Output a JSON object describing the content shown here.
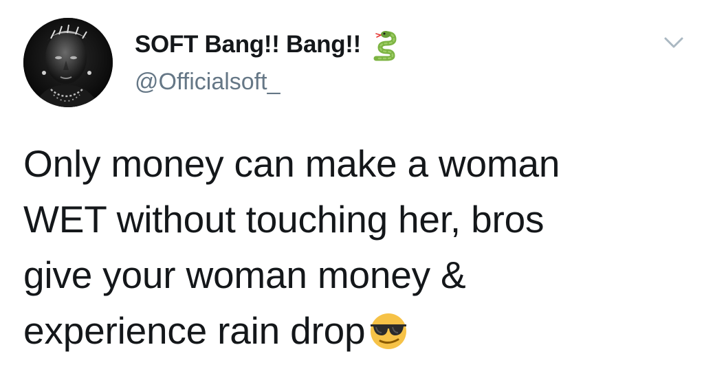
{
  "user": {
    "display_name": "SOFT Bang!! Bang!!",
    "handle": "@Officialsoft_",
    "name_icon": "snake-emoji",
    "avatar_icon": "profile-photo"
  },
  "header": {
    "menu_icon": "chevron-down-icon"
  },
  "tweet": {
    "lines": [
      "Only money can make a woman",
      "WET without touching her, bros",
      "give your woman money &",
      "experience rain drop"
    ],
    "trailing_emoji": "smiling-face-with-sunglasses-emoji"
  },
  "colors": {
    "text": "#14171a",
    "secondary_text": "#657786",
    "caret": "#aab8c2",
    "snake_green": "#7cb342",
    "emoji_yellow": "#f6c247"
  }
}
